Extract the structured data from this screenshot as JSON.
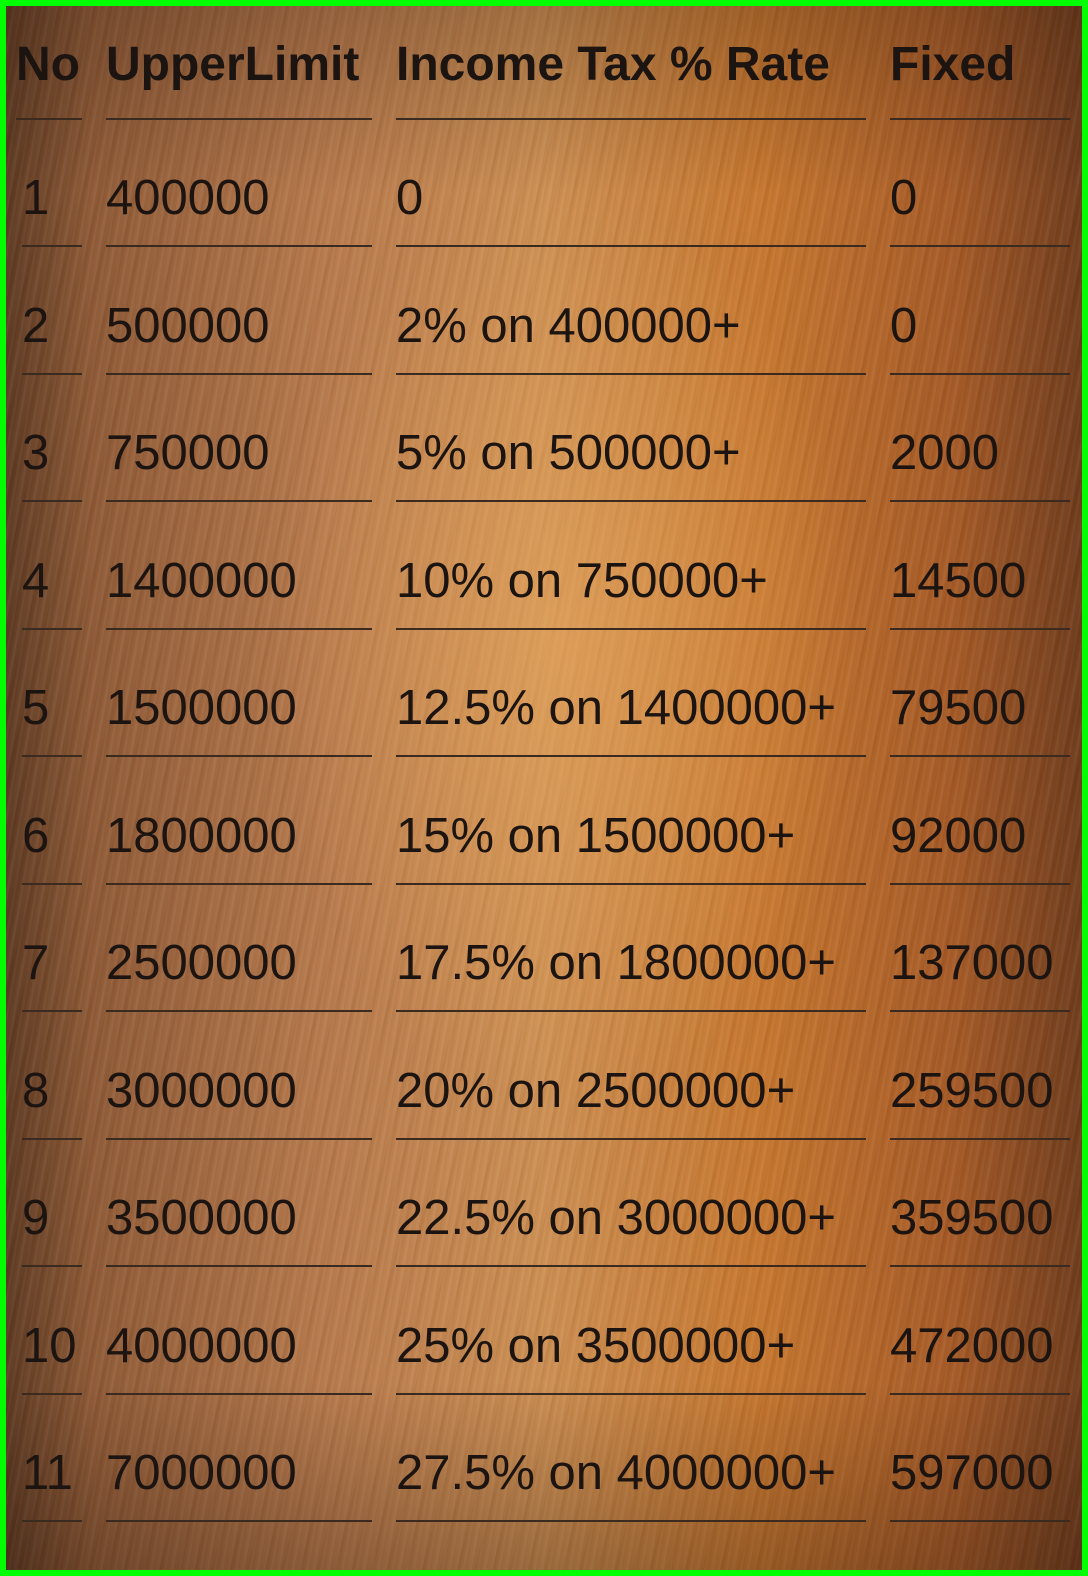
{
  "table": {
    "headers": {
      "no": "No",
      "upper_limit": "UpperLimit",
      "rate": "Income Tax % Rate",
      "fixed": "Fixed"
    },
    "rows": [
      {
        "no": "1",
        "upper_limit": "400000",
        "rate": "0",
        "fixed": "0"
      },
      {
        "no": "2",
        "upper_limit": "500000",
        "rate": "2% on 400000+",
        "fixed": "0"
      },
      {
        "no": "3",
        "upper_limit": "750000",
        "rate": "5% on 500000+",
        "fixed": "2000"
      },
      {
        "no": "4",
        "upper_limit": "1400000",
        "rate": "10% on 750000+",
        "fixed": "14500"
      },
      {
        "no": "5",
        "upper_limit": "1500000",
        "rate": "12.5% on 1400000+",
        "fixed": "79500"
      },
      {
        "no": "6",
        "upper_limit": "1800000",
        "rate": "15% on 1500000+",
        "fixed": "92000"
      },
      {
        "no": "7",
        "upper_limit": "2500000",
        "rate": "17.5% on 1800000+",
        "fixed": "137000"
      },
      {
        "no": "8",
        "upper_limit": "3000000",
        "rate": "20% on 2500000+",
        "fixed": "259500"
      },
      {
        "no": "9",
        "upper_limit": "3500000",
        "rate": "22.5% on 3000000+",
        "fixed": "359500"
      },
      {
        "no": "10",
        "upper_limit": "4000000",
        "rate": "25% on 3500000+",
        "fixed": "472000"
      },
      {
        "no": "11",
        "upper_limit": "7000000",
        "rate": "27.5% on 4000000+",
        "fixed": "597000"
      }
    ]
  },
  "colors": {
    "frame_border": "#00ff00",
    "text": "#1c1411",
    "underline": "#3b2a1f",
    "wood_light": "#cd8f52",
    "wood_dark": "#5e3a22"
  }
}
